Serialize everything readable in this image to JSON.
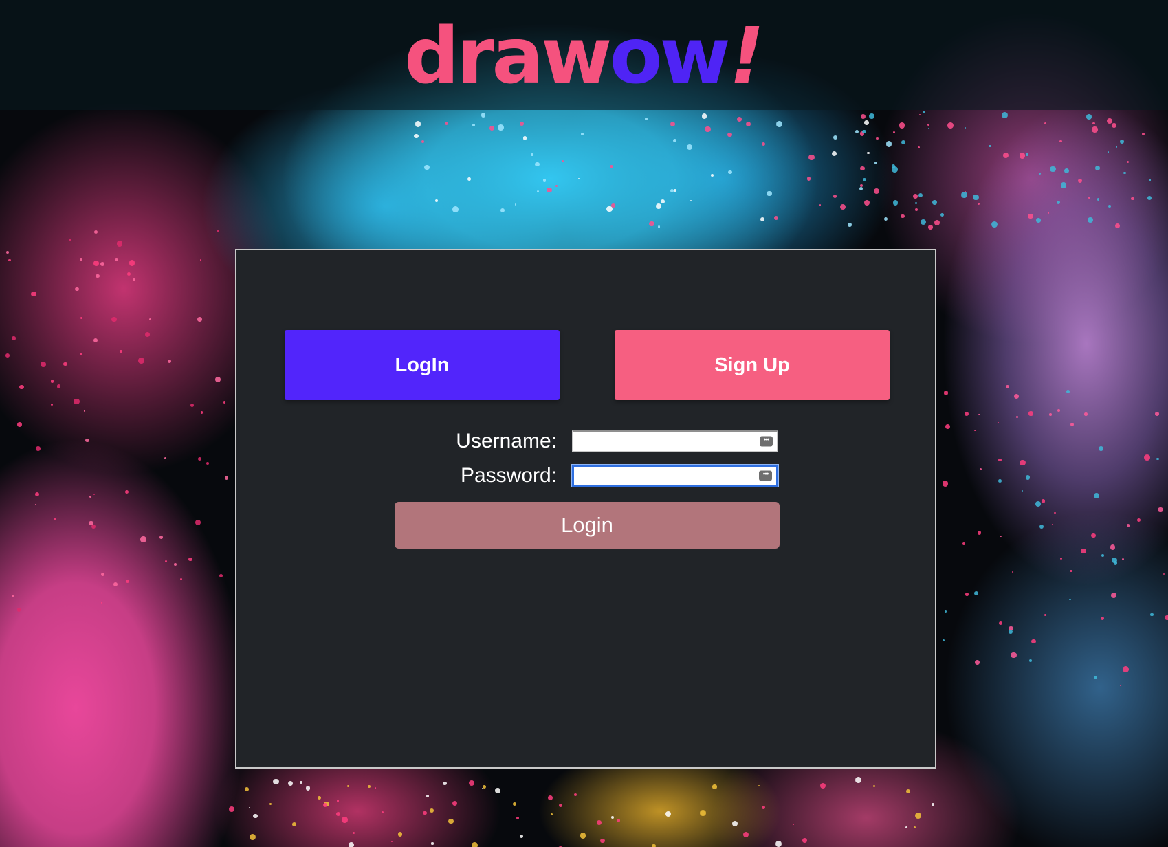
{
  "header": {
    "logo": {
      "part_pink": "draw",
      "part_purple": "ow",
      "part_exclaim": "!"
    }
  },
  "tabs": {
    "login_label": "LogIn",
    "signup_label": "Sign Up"
  },
  "form": {
    "username_label": "Username:",
    "username_value": "",
    "password_label": "Password:",
    "password_value": "",
    "submit_label": "Login"
  },
  "colors": {
    "logo_pink": "#f5527e",
    "logo_purple": "#4f24f5",
    "login_tab": "#5225fb",
    "signup_tab": "#f65f81",
    "submit_button": "#b2757b",
    "panel_bg": "#212428"
  },
  "icons": {
    "autofill": "password-manager-key-icon"
  }
}
